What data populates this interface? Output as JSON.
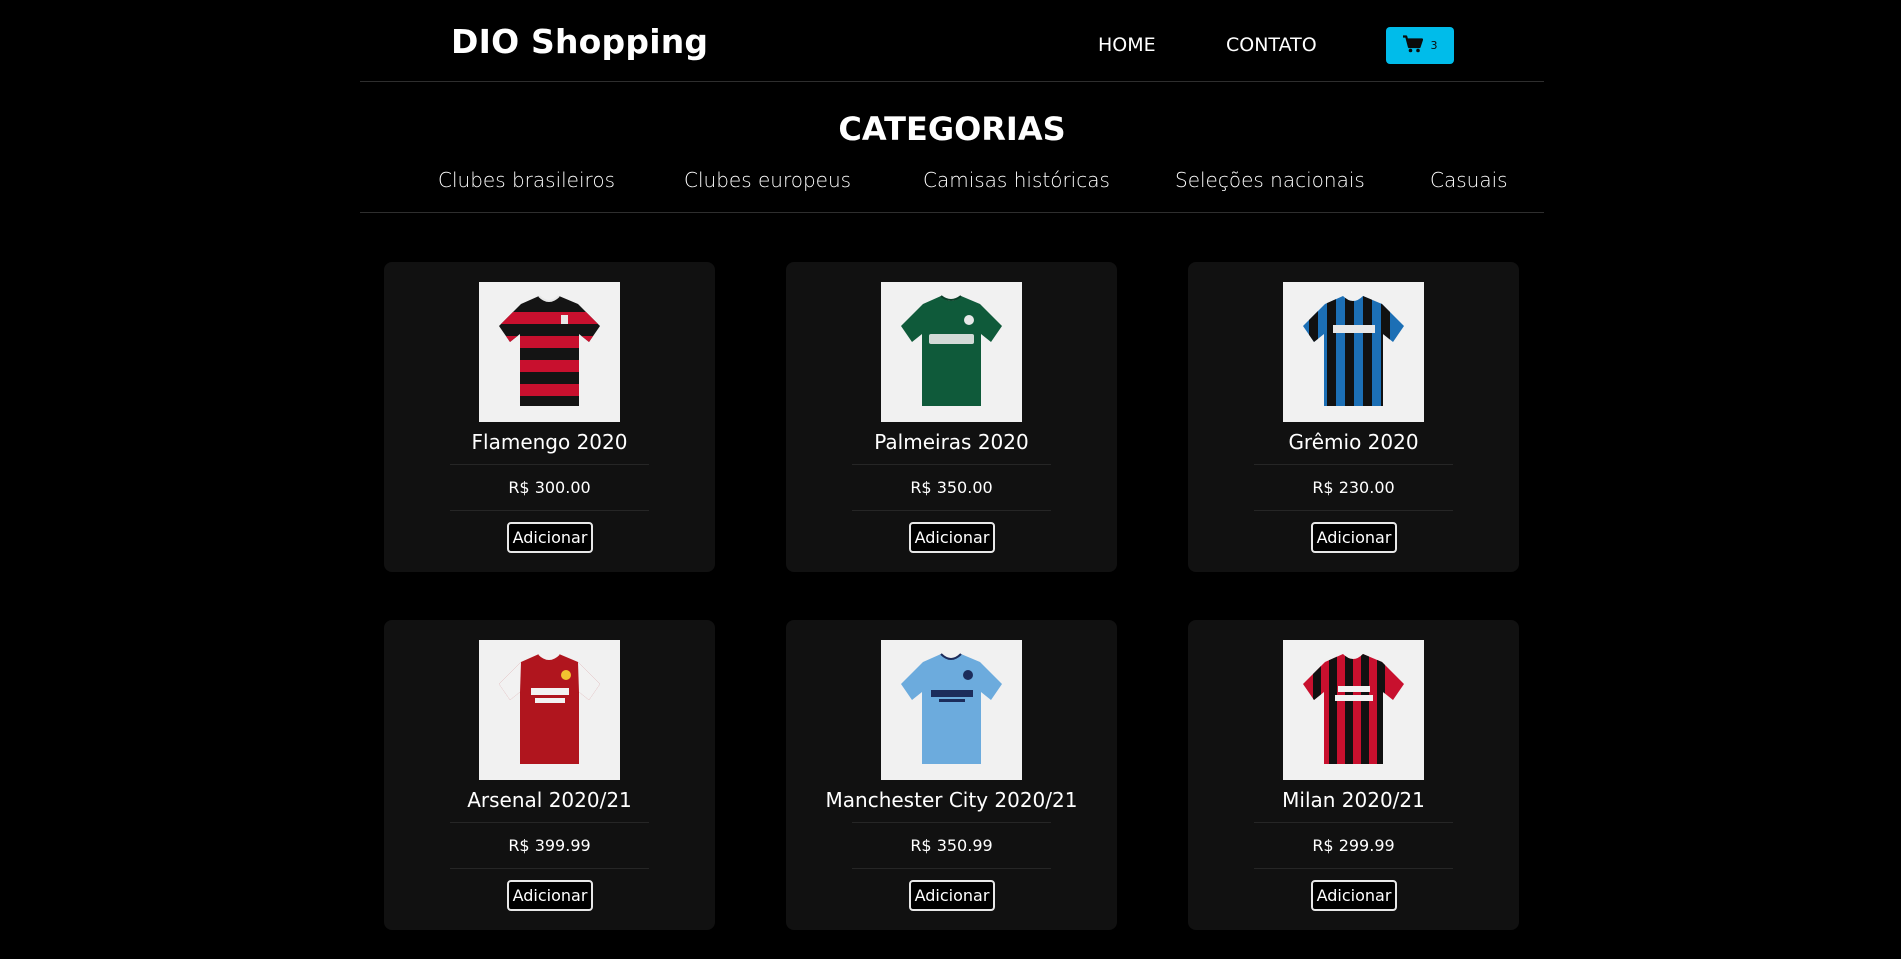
{
  "header": {
    "brand": "DIO Shopping",
    "nav": [
      "HOME",
      "CONTATO"
    ],
    "cart": {
      "icon": "shopping-cart-icon",
      "count": "3",
      "color": "#00bcea"
    }
  },
  "categories": {
    "title": "CATEGORIAS",
    "items": [
      "Clubes brasileiros",
      "Clubes europeus",
      "Camisas históricas",
      "Seleções nacionais",
      "Casuais"
    ]
  },
  "products": [
    {
      "name": "Flamengo 2020",
      "price": "R$ 300.00",
      "button": "Adicionar",
      "image": "flamengo-shirt"
    },
    {
      "name": "Palmeiras 2020",
      "price": "R$ 350.00",
      "button": "Adicionar",
      "image": "palmeiras-shirt"
    },
    {
      "name": "Grêmio 2020",
      "price": "R$ 230.00",
      "button": "Adicionar",
      "image": "gremio-shirt"
    },
    {
      "name": "Arsenal 2020/21",
      "price": "R$ 399.99",
      "button": "Adicionar",
      "image": "arsenal-shirt"
    },
    {
      "name": "Manchester City 2020/21",
      "price": "R$ 350.99",
      "button": "Adicionar",
      "image": "manchester-city-shirt"
    },
    {
      "name": "Milan 2020/21",
      "price": "R$ 299.99",
      "button": "Adicionar",
      "image": "milan-shirt"
    }
  ],
  "colors": {
    "background": "#000000",
    "card": "#111111",
    "accent": "#00bcea"
  }
}
